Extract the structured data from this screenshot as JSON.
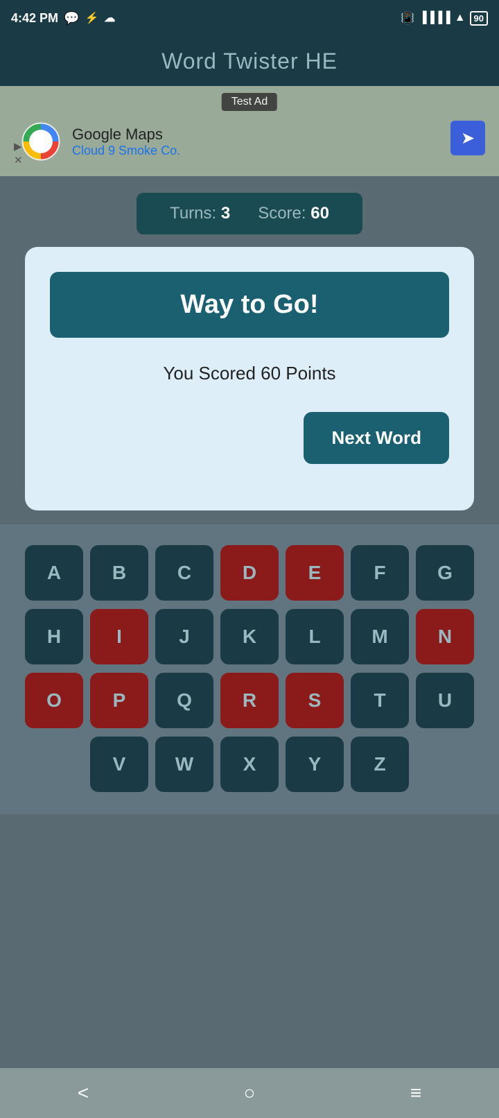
{
  "statusBar": {
    "time": "4:42 PM",
    "battery": "90"
  },
  "header": {
    "title": "Word Twister HE"
  },
  "ad": {
    "label": "Test Ad",
    "name": "Google Maps",
    "sub": "Cloud 9 Smoke Co.",
    "play_icon": "▶",
    "close_icon": "✕",
    "arrow_icon": "➤"
  },
  "scoreBar": {
    "turns_label": "Turns:",
    "turns_value": "3",
    "score_label": "Score:",
    "score_value": "60"
  },
  "modal": {
    "title": "Way to Go!",
    "score_text": "You Scored 60 Points",
    "next_button": "Next Word"
  },
  "keyboard": {
    "rows": [
      [
        "A",
        "B",
        "C",
        "D",
        "E",
        "F",
        "G"
      ],
      [
        "H",
        "I",
        "J",
        "K",
        "L",
        "M",
        "N"
      ],
      [
        "O",
        "P",
        "Q",
        "R",
        "S",
        "T",
        "U"
      ],
      [
        "V",
        "W",
        "X",
        "Y",
        "Z"
      ]
    ],
    "used_keys": [
      "D",
      "E",
      "I",
      "N",
      "O",
      "P",
      "R",
      "S"
    ]
  },
  "nav": {
    "back": "<",
    "home": "○",
    "menu": "≡"
  }
}
